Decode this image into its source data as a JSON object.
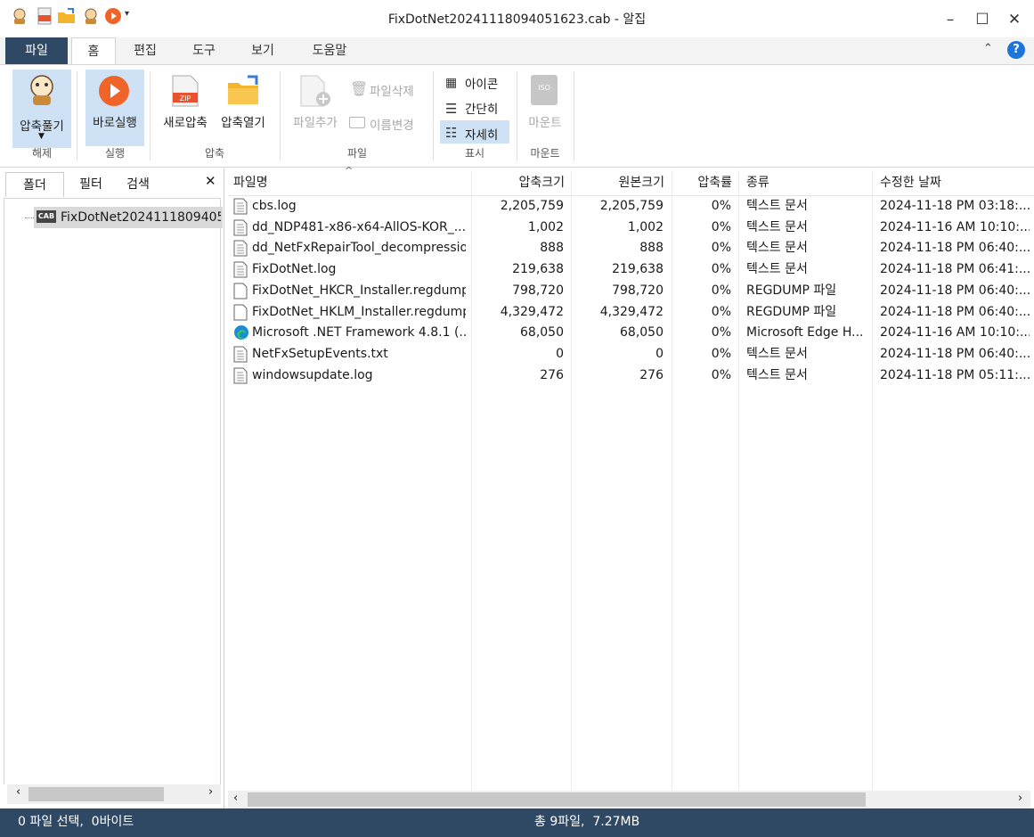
{
  "window": {
    "title": "FixDotNet20241118094051623.cab - 알집",
    "minimize": "–",
    "maximize": "☐",
    "close": "✕"
  },
  "menu_tabs": [
    {
      "label": "파일"
    },
    {
      "label": "홈"
    },
    {
      "label": "편집"
    },
    {
      "label": "도구"
    },
    {
      "label": "보기"
    },
    {
      "label": "도움말"
    }
  ],
  "ribbon": {
    "extract": {
      "button": "압축풀기",
      "group": "해제"
    },
    "run": {
      "button": "바로실행",
      "group": "실행"
    },
    "compress": {
      "new": "새로압축",
      "open": "압축열기",
      "group": "압축"
    },
    "file": {
      "add": "파일추가",
      "delete": "파일삭제",
      "rename": "이름변경",
      "group": "파일"
    },
    "view": {
      "icons": "아이콘",
      "simple": "간단히",
      "details": "자세히",
      "group": "표시"
    },
    "mount": {
      "button": "마운트",
      "group": "마운트",
      "iso": "ISO"
    }
  },
  "left_tabs": [
    {
      "label": "폴더"
    },
    {
      "label": "필터"
    },
    {
      "label": "검색"
    }
  ],
  "tree": {
    "root": "FixDotNet2024111809405",
    "badge": "CAB"
  },
  "columns": {
    "name": "파일명",
    "compressed": "압축크기",
    "original": "원본크기",
    "ratio": "압축률",
    "type": "종류",
    "modified": "수정한 날짜"
  },
  "files": [
    {
      "name": "cbs.log",
      "compressed": "2,205,759",
      "original": "2,205,759",
      "ratio": "0%",
      "type": "텍스트 문서",
      "modified": "2024-11-18 PM 03:18:..."
    },
    {
      "name": "dd_NDP481-x86-x64-AllOS-KOR_...",
      "compressed": "1,002",
      "original": "1,002",
      "ratio": "0%",
      "type": "텍스트 문서",
      "modified": "2024-11-16 AM 10:10:..."
    },
    {
      "name": "dd_NetFxRepairTool_decompressio...",
      "compressed": "888",
      "original": "888",
      "ratio": "0%",
      "type": "텍스트 문서",
      "modified": "2024-11-18 PM 06:40:..."
    },
    {
      "name": "FixDotNet.log",
      "compressed": "219,638",
      "original": "219,638",
      "ratio": "0%",
      "type": "텍스트 문서",
      "modified": "2024-11-18 PM 06:41:..."
    },
    {
      "name": "FixDotNet_HKCR_Installer.regdump",
      "compressed": "798,720",
      "original": "798,720",
      "ratio": "0%",
      "type": "REGDUMP 파일",
      "modified": "2024-11-18 PM 06:40:..."
    },
    {
      "name": "FixDotNet_HKLM_Installer.regdump",
      "compressed": "4,329,472",
      "original": "4,329,472",
      "ratio": "0%",
      "type": "REGDUMP 파일",
      "modified": "2024-11-18 PM 06:40:..."
    },
    {
      "name": "Microsoft .NET Framework 4.8.1 (...",
      "compressed": "68,050",
      "original": "68,050",
      "ratio": "0%",
      "type": "Microsoft Edge H...",
      "modified": "2024-11-16 AM 10:10:..."
    },
    {
      "name": "NetFxSetupEvents.txt",
      "compressed": "0",
      "original": "0",
      "ratio": "0%",
      "type": "텍스트 문서",
      "modified": "2024-11-18 PM 06:40:..."
    },
    {
      "name": "windowsupdate.log",
      "compressed": "276",
      "original": "276",
      "ratio": "0%",
      "type": "텍스트 문서",
      "modified": "2024-11-18 PM 05:11:..."
    }
  ],
  "file_icons": [
    "text-file-icon",
    "text-file-icon",
    "text-file-icon",
    "text-file-icon",
    "blank-file-icon",
    "blank-file-icon",
    "edge-icon",
    "text-file-icon",
    "text-file-icon"
  ],
  "status": {
    "left": "0 파일 선택,  0바이트",
    "center": "총 9파일,  7.27MB"
  },
  "colors": {
    "accent": "#2f4863",
    "selected": "#cfe1f5",
    "play": "#f0642a"
  }
}
